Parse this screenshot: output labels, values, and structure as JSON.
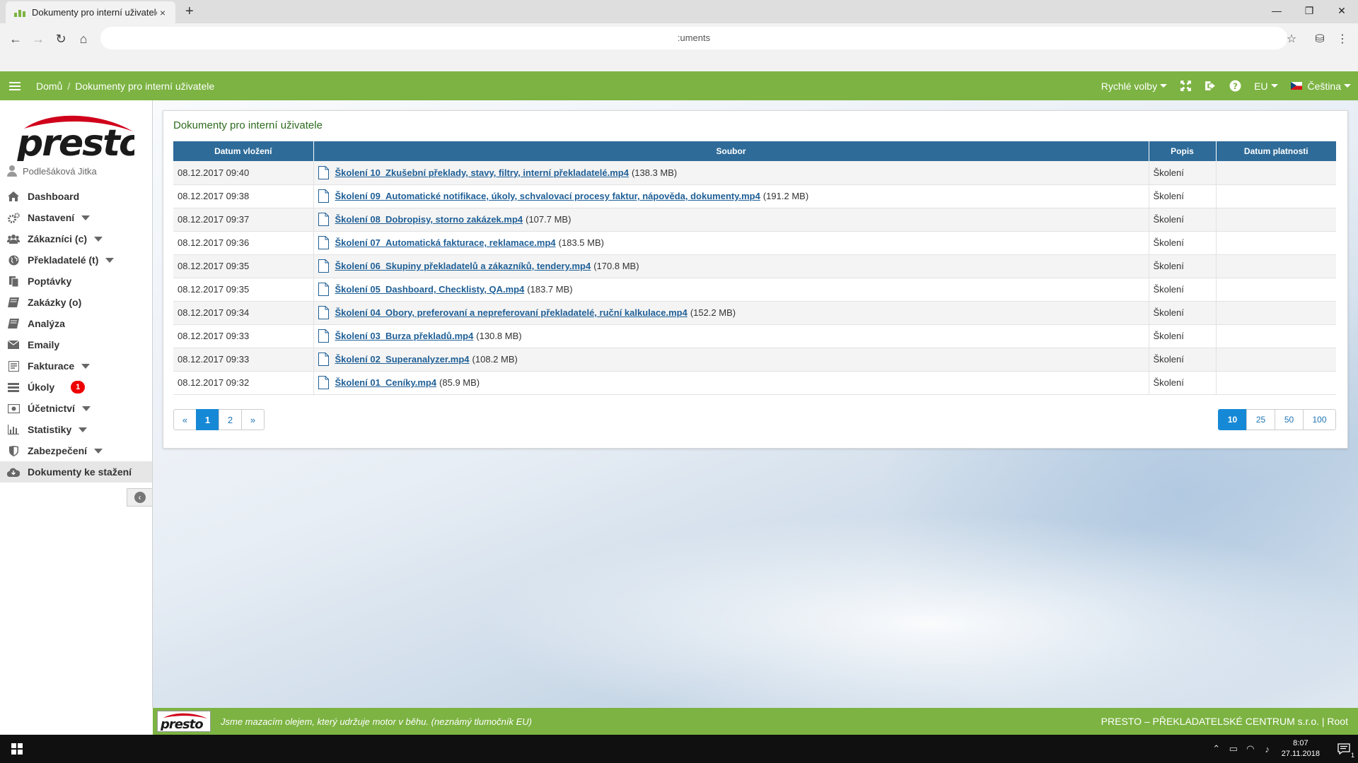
{
  "browser": {
    "tab_title": "Dokumenty pro interní uživatele",
    "tab_close": "×",
    "new_tab": "+",
    "address": ":uments",
    "win_minimize": "—",
    "win_restore": "❐",
    "win_close": "✕"
  },
  "header": {
    "breadcrumb_home": "Domů",
    "breadcrumb_sep": "/",
    "breadcrumb_current": "Dokumenty pro interní uživatele",
    "quick_options": "Rychlé volby",
    "region": "EU",
    "language": "Čeština"
  },
  "sidebar": {
    "logo_text": "presto",
    "user_name": "Podlešáková Jitka",
    "items": [
      {
        "label": "Dashboard",
        "icon": "home-icon"
      },
      {
        "label": "Nastavení",
        "icon": "cogs-icon"
      },
      {
        "label": "Zákazníci (c)",
        "icon": "users-icon"
      },
      {
        "label": "Překladatelé (t)",
        "icon": "globe-icon"
      },
      {
        "label": "Poptávky",
        "icon": "files-icon"
      },
      {
        "label": "Zakázky (o)",
        "icon": "book-icon"
      },
      {
        "label": "Analýza",
        "icon": "book-icon"
      },
      {
        "label": "Emaily",
        "icon": "envelope-icon"
      },
      {
        "label": "Fakturace",
        "icon": "invoice-icon"
      },
      {
        "label": "Úkoly",
        "icon": "tasks-icon",
        "badge": "1"
      },
      {
        "label": "Účetnictví",
        "icon": "money-icon"
      },
      {
        "label": "Statistiky",
        "icon": "chart-icon"
      },
      {
        "label": "Zabezpečení",
        "icon": "shield-icon"
      },
      {
        "label": "Dokumenty ke stažení",
        "icon": "cloud-download-icon"
      }
    ]
  },
  "panel": {
    "title": "Dokumenty pro interní uživatele",
    "columns": [
      "Datum vložení",
      "Soubor",
      "Popis",
      "Datum platnosti"
    ],
    "rows": [
      {
        "date": "08.12.2017 09:40",
        "file": "Školení 10_Zkušební překlady, stavy, filtry, interní překladatelé.mp4",
        "size": "(138.3 MB)",
        "desc": "Školení",
        "valid": ""
      },
      {
        "date": "08.12.2017 09:38",
        "file": "Školení 09_Automatické notifikace, úkoly, schvalovací procesy faktur, nápověda, dokumenty.mp4",
        "size": "(191.2 MB)",
        "desc": "Školení",
        "valid": ""
      },
      {
        "date": "08.12.2017 09:37",
        "file": "Školení 08_Dobropisy, storno zakázek.mp4",
        "size": "(107.7 MB)",
        "desc": "Školení",
        "valid": ""
      },
      {
        "date": "08.12.2017 09:36",
        "file": "Školení 07_Automatická fakturace, reklamace.mp4",
        "size": "(183.5 MB)",
        "desc": "Školení",
        "valid": ""
      },
      {
        "date": "08.12.2017 09:35",
        "file": "Školení 06_Skupiny překladatelů a zákazníků, tendery.mp4",
        "size": "(170.8 MB)",
        "desc": "Školení",
        "valid": ""
      },
      {
        "date": "08.12.2017 09:35",
        "file": "Školení 05_Dashboard, Checklisty, QA.mp4",
        "size": "(183.7 MB)",
        "desc": "Školení",
        "valid": ""
      },
      {
        "date": "08.12.2017 09:34",
        "file": "Školení 04_Obory, preferovaní a nepreferovaní překladatelé, ruční kalkulace.mp4",
        "size": "(152.2 MB)",
        "desc": "Školení",
        "valid": ""
      },
      {
        "date": "08.12.2017 09:33",
        "file": "Školení 03_Burza překladů.mp4",
        "size": "(130.8 MB)",
        "desc": "Školení",
        "valid": ""
      },
      {
        "date": "08.12.2017 09:33",
        "file": "Školení 02_Superanalyzer.mp4",
        "size": "(108.2 MB)",
        "desc": "Školení",
        "valid": ""
      },
      {
        "date": "08.12.2017 09:32",
        "file": "Školení 01_Ceníky.mp4",
        "size": "(85.9 MB)",
        "desc": "Školení",
        "valid": ""
      }
    ],
    "pagination": [
      "«",
      "1",
      "2",
      "»"
    ],
    "active_page": "1",
    "page_sizes": [
      "10",
      "25",
      "50",
      "100"
    ],
    "active_size": "10"
  },
  "footer": {
    "logo_text": "presto",
    "slogan": "Jsme mazacím olejem, který udržuje motor v běhu. (neznámý tlumočník EU)",
    "company": "PRESTO – PŘEKLADATELSKÉ CENTRUM s.r.o. | Root"
  },
  "taskbar": {
    "time": "8:07",
    "date": "27.11.2018",
    "notifications": "1"
  },
  "colors": {
    "brand_green": "#7cb342",
    "table_header": "#2e6b99",
    "link": "#1f5f96",
    "active_blue": "#1689d6",
    "logo_red": "#d0021b"
  }
}
